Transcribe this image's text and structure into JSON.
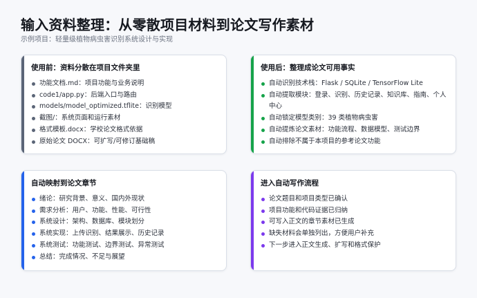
{
  "header": {
    "title": "输入资料整理：从零散项目材料到论文写作素材",
    "subtitle": "示例项目：轻量级植物病虫害识别系统设计与实现"
  },
  "colors": {
    "before": "#5b6577",
    "after": "#16a34a",
    "chapters": "#2563eb",
    "writing": "#7c3aed"
  },
  "cards": {
    "before": {
      "title": "使用前：资料分散在项目文件夹里",
      "items": [
        "功能文档.md：项目功能与业务说明",
        "code1/app.py：后端入口与路由",
        "models/model_optimized.tflite：识别模型",
        "截图/：系统页面和运行素材",
        "格式模板.docx：学校论文格式依据",
        "原始论文 DOCX：可扩写/可修订基础稿"
      ]
    },
    "after": {
      "title": "使用后：整理成论文可用事实",
      "items": [
        "自动识别技术栈：Flask / SQLite / TensorFlow Lite",
        "自动提取模块：登录、识别、历史记录、知识库、指南、个人中心",
        "自动锁定模型类别：39 类植物病虫害",
        "自动提炼论文素材：功能流程、数据模型、测试边界",
        "自动排除不属于本项目的参考论文功能"
      ]
    },
    "chapters": {
      "title": "自动映射到论文章节",
      "items": [
        "绪论：研究背景、意义、国内外现状",
        "需求分析：用户、功能、性能、可行性",
        "系统设计：架构、数据库、模块划分",
        "系统实现：上传识别、结果展示、历史记录",
        "系统测试：功能测试、边界测试、异常测试",
        "总结：完成情况、不足与展望"
      ]
    },
    "writing": {
      "title": "进入自动写作流程",
      "items": [
        "论文题目和项目类型已确认",
        "项目功能和代码证据已归纳",
        "可写入正文的章节素材已生成",
        "缺失材料会单独列出，方便用户补充",
        "下一步进入正文生成、扩写和格式保护"
      ]
    }
  }
}
